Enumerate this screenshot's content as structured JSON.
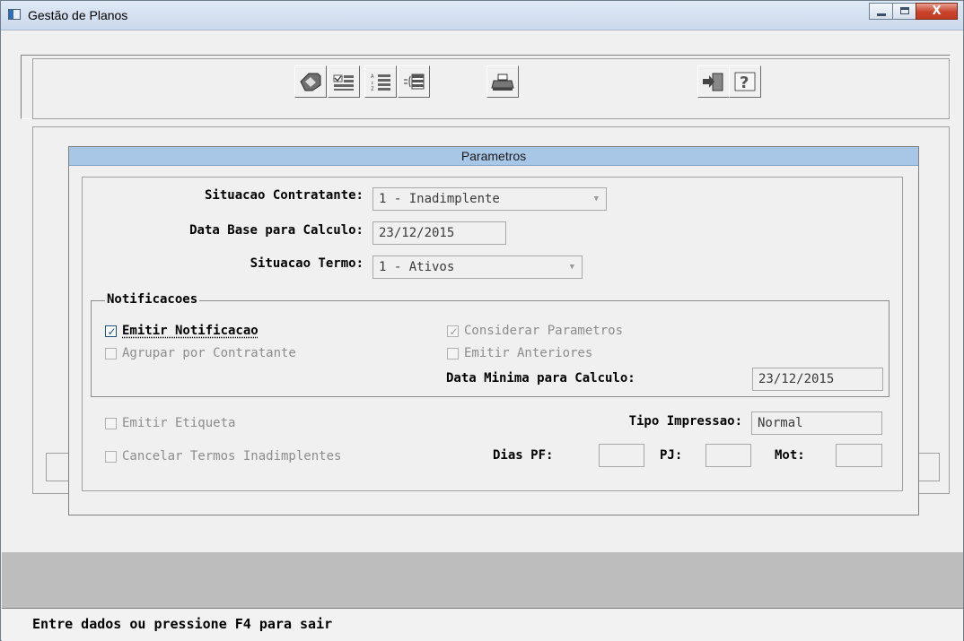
{
  "window": {
    "title": "Gestão de Planos",
    "close_glyph": "X"
  },
  "toolbar": {
    "icons": [
      "edit-icon",
      "checklist-icon",
      "sort-icon",
      "list-icon",
      "print-icon",
      "exit-icon",
      "help-icon"
    ]
  },
  "dialog": {
    "title": "Parametros",
    "situacao_contratante": {
      "label": "Situacao Contratante:",
      "value": "1 - Inadimplente"
    },
    "data_base": {
      "label": "Data Base para Calculo:",
      "value": "23/12/2015"
    },
    "situacao_termo": {
      "label": "Situacao Termo:",
      "value": "1 - Ativos"
    },
    "notificacoes": {
      "legend": "Notificacoes",
      "emitir_notificacao": {
        "label": "Emitir Notificacao",
        "checked": true
      },
      "agrupar_contratante": {
        "label": "Agrupar por Contratante",
        "checked": false
      },
      "considerar_parametros": {
        "label": "Considerar Parametros",
        "checked": true
      },
      "emitir_anteriores": {
        "label": "Emitir Anteriores",
        "checked": false
      },
      "data_minima": {
        "label": "Data Minima para Calculo:",
        "value": "23/12/2015"
      }
    },
    "emitir_etiqueta": {
      "label": "Emitir Etiqueta",
      "checked": false
    },
    "tipo_impressao": {
      "label": "Tipo Impressao:",
      "value": "Normal"
    },
    "cancelar_termos": {
      "label": "Cancelar Termos Inadimplentes",
      "checked": false
    },
    "dias_pf": {
      "label": "Dias PF:",
      "value": ""
    },
    "pj": {
      "label": "PJ:",
      "value": ""
    },
    "mot": {
      "label": "Mot:",
      "value": ""
    }
  },
  "status": {
    "message": "Entre dados ou pressione F4 para sair"
  },
  "colors": {
    "dialog_title_bg": "#a8c6e6",
    "close_button": "#c8432b",
    "status_band": "#bdbdbd"
  }
}
